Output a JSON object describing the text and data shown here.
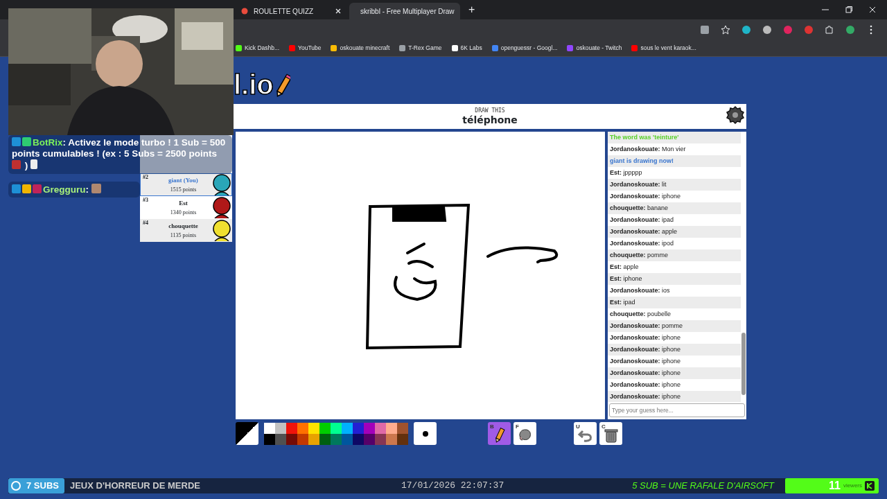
{
  "browser": {
    "tabs": [
      {
        "title": "ROULETTE QUIZZ",
        "selected": false
      },
      {
        "title": "skribbl - Free Multiplayer Draw",
        "selected": true
      }
    ],
    "new_tab": "+",
    "bookmarks": [
      {
        "label": "Kick Dashb...",
        "color": "#53fc18"
      },
      {
        "label": "YouTube",
        "color": "#ff0000"
      },
      {
        "label": "oskouate minecraft",
        "color": "#fbbc05"
      },
      {
        "label": "T-Rex Game",
        "color": "#9aa0a6"
      },
      {
        "label": "6K Labs",
        "color": "#ffffff"
      },
      {
        "label": "openguessr - Googl...",
        "color": "#4285f4"
      },
      {
        "label": "oskouate - Twitch",
        "color": "#9146ff"
      },
      {
        "label": "sous le vent karaok...",
        "color": "#ff0000"
      }
    ]
  },
  "logo": "l.io",
  "game_header": {
    "caption": "DRAW THIS",
    "word": "téléphone"
  },
  "leaderboard": [
    {
      "rank": "#2",
      "name": "giant (You)",
      "points": "1515 points",
      "you": true
    },
    {
      "rank": "#3",
      "name": "Est",
      "points": "1340 points",
      "you": false
    },
    {
      "rank": "#4",
      "name": "chouquette",
      "points": "1135 points",
      "you": false
    }
  ],
  "stream_chat": [
    {
      "user": "BotRix",
      "text": ": Activez le mode turbo ! 1 Sub = 500 points cumulables ! (ex : 5 Subs = 2500 points",
      "tail": ")",
      "badges": [
        {
          "kind": "moderator"
        },
        {
          "kind": "verified"
        }
      ]
    },
    {
      "user": "Gregguru",
      "text": ":",
      "badges": [
        {
          "kind": "moderator"
        },
        {
          "kind": "vip"
        },
        {
          "kind": "subscriber"
        }
      ]
    }
  ],
  "chat": [
    {
      "kind": "system",
      "color": "#56ce27",
      "text": "The word was 'teinture'"
    },
    {
      "kind": "message",
      "user": "Jordanoskouate:",
      "text": "Mon vier"
    },
    {
      "kind": "system",
      "color": "#3975ce",
      "text": "giant is drawing now!"
    },
    {
      "kind": "message",
      "user": "Est:",
      "text": "jppppp"
    },
    {
      "kind": "message",
      "user": "Jordanoskouate:",
      "text": "lit"
    },
    {
      "kind": "message",
      "user": "Jordanoskouate:",
      "text": "iphone"
    },
    {
      "kind": "message",
      "user": "chouquette:",
      "text": "banane"
    },
    {
      "kind": "message",
      "user": "Jordanoskouate:",
      "text": "ipad"
    },
    {
      "kind": "message",
      "user": "Jordanoskouate:",
      "text": "apple"
    },
    {
      "kind": "message",
      "user": "Jordanoskouate:",
      "text": "ipod"
    },
    {
      "kind": "message",
      "user": "chouquette:",
      "text": "pomme"
    },
    {
      "kind": "message",
      "user": "Est:",
      "text": "apple"
    },
    {
      "kind": "message",
      "user": "Est:",
      "text": "iphone"
    },
    {
      "kind": "message",
      "user": "Jordanoskouate:",
      "text": "ios"
    },
    {
      "kind": "message",
      "user": "Est:",
      "text": "ipad"
    },
    {
      "kind": "message",
      "user": "chouquette:",
      "text": "poubelle"
    },
    {
      "kind": "message",
      "user": "Jordanoskouate:",
      "text": "pomme"
    },
    {
      "kind": "message",
      "user": "Jordanoskouate:",
      "text": "iphone"
    },
    {
      "kind": "message",
      "user": "Jordanoskouate:",
      "text": "iphone"
    },
    {
      "kind": "message",
      "user": "Jordanoskouate:",
      "text": "iphone"
    },
    {
      "kind": "message",
      "user": "Jordanoskouate:",
      "text": "iphone"
    },
    {
      "kind": "message",
      "user": "Jordanoskouate:",
      "text": "iphone"
    },
    {
      "kind": "message",
      "user": "Jordanoskouate:",
      "text": "iphone"
    }
  ],
  "guess_input": {
    "placeholder": "Type your guess here..."
  },
  "toolbar": {
    "palette": [
      {
        "color": "#ffffff"
      },
      {
        "color": "#c1c1c1"
      },
      {
        "color": "#ef130b"
      },
      {
        "color": "#ff7100"
      },
      {
        "color": "#ffe400"
      },
      {
        "color": "#00cc00"
      },
      {
        "color": "#00ff91"
      },
      {
        "color": "#00b2ff"
      },
      {
        "color": "#231fd3"
      },
      {
        "color": "#a300ba"
      },
      {
        "color": "#df69a7"
      },
      {
        "color": "#ffac8e"
      },
      {
        "color": "#a0522d"
      },
      {
        "color": "#000000"
      },
      {
        "color": "#505050"
      },
      {
        "color": "#740b07"
      },
      {
        "color": "#c23800"
      },
      {
        "color": "#e8a200"
      },
      {
        "color": "#005f10"
      },
      {
        "color": "#00785d"
      },
      {
        "color": "#00569e"
      },
      {
        "color": "#0e0865"
      },
      {
        "color": "#550069"
      },
      {
        "color": "#873554"
      },
      {
        "color": "#cc774d"
      },
      {
        "color": "#63300d"
      }
    ],
    "tools": [
      {
        "kind": "brush",
        "key": "B",
        "selected": true
      },
      {
        "kind": "fill",
        "key": "F",
        "selected": false
      }
    ],
    "actions": [
      {
        "kind": "undo",
        "key": "U"
      },
      {
        "kind": "clear",
        "key": "C"
      }
    ]
  },
  "stream_bar": {
    "subs": "7 SUBS",
    "title": "JEUX D'HORREUR DE MERDE",
    "datetime": "17/01/2026 22:07:37",
    "goal": "5 SUB = UNE RAFALE D'AIRSOFT",
    "viewers": "11",
    "viewers_label": "viewers"
  }
}
